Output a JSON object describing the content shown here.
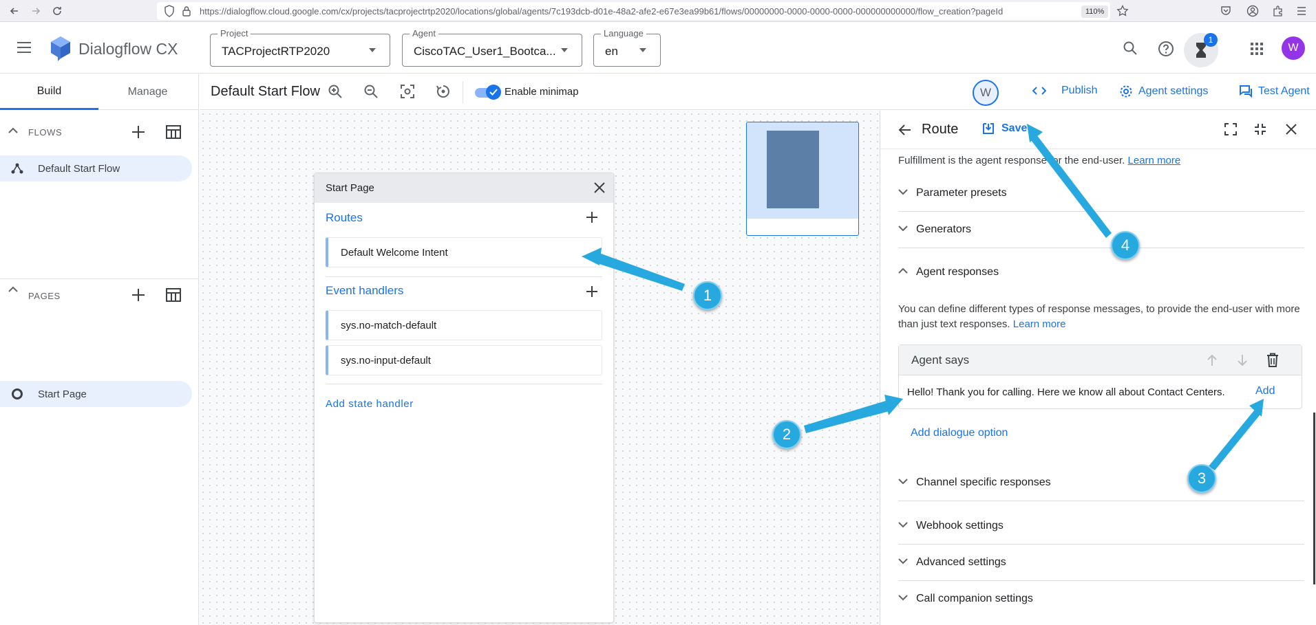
{
  "browser": {
    "url": "https://dialogflow.cloud.google.com/cx/projects/tacprojectrtp2020/locations/global/agents/7c193dcb-d01e-48a2-afe2-e67e3ea99b61/flows/00000000-0000-0000-0000-000000000000/flow_creation?pageId",
    "zoom": "110%"
  },
  "app": {
    "name": "Dialogflow CX",
    "project_label": "Project",
    "project_value": "TACProjectRTP2020",
    "agent_label": "Agent",
    "agent_value": "CiscoTAC_User1_Bootca...",
    "language_label": "Language",
    "language_value": "en",
    "notification_count": "1",
    "user_initial": "W"
  },
  "left": {
    "tabs": [
      {
        "label": "Build"
      },
      {
        "label": "Manage"
      }
    ],
    "flows_title": "FLOWS",
    "flow_item": "Default Start Flow",
    "pages_title": "PAGES",
    "page_item": "Start Page"
  },
  "toolbar": {
    "flow_title": "Default Start Flow",
    "minimap_label": "Enable minimap",
    "user_initial": "W",
    "publish": "Publish",
    "agent_settings": "Agent settings",
    "test_agent": "Test Agent"
  },
  "card": {
    "title": "Start Page",
    "routes_title": "Routes",
    "route_1": "Default Welcome Intent",
    "events_title": "Event handlers",
    "event_1": "sys.no-match-default",
    "event_2": "sys.no-input-default",
    "add_state": "Add state handler"
  },
  "route_panel": {
    "title": "Route",
    "save": "Save",
    "fulfillment_text": "Fulfillment is the agent response for the end-user.",
    "learn_more": "Learn more",
    "sections": {
      "parameter_presets": "Parameter presets",
      "generators": "Generators",
      "agent_responses": "Agent responses",
      "channel_specific": "Channel specific responses",
      "webhook": "Webhook settings",
      "advanced": "Advanced settings",
      "call_companion": "Call companion settings"
    },
    "agent_responses_desc": "You can define different types of response messages, to provide the end-user with more than just text responses.",
    "agent_says": "Agent says",
    "response_text": "Hello! Thank you for calling. Here we know all about Contact Centers.",
    "add": "Add",
    "add_dialogue": "Add dialogue option"
  },
  "annotations": [
    "1",
    "2",
    "3",
    "4"
  ],
  "colors": {
    "accent": "#1a73e8",
    "badge": "#27a9df"
  }
}
